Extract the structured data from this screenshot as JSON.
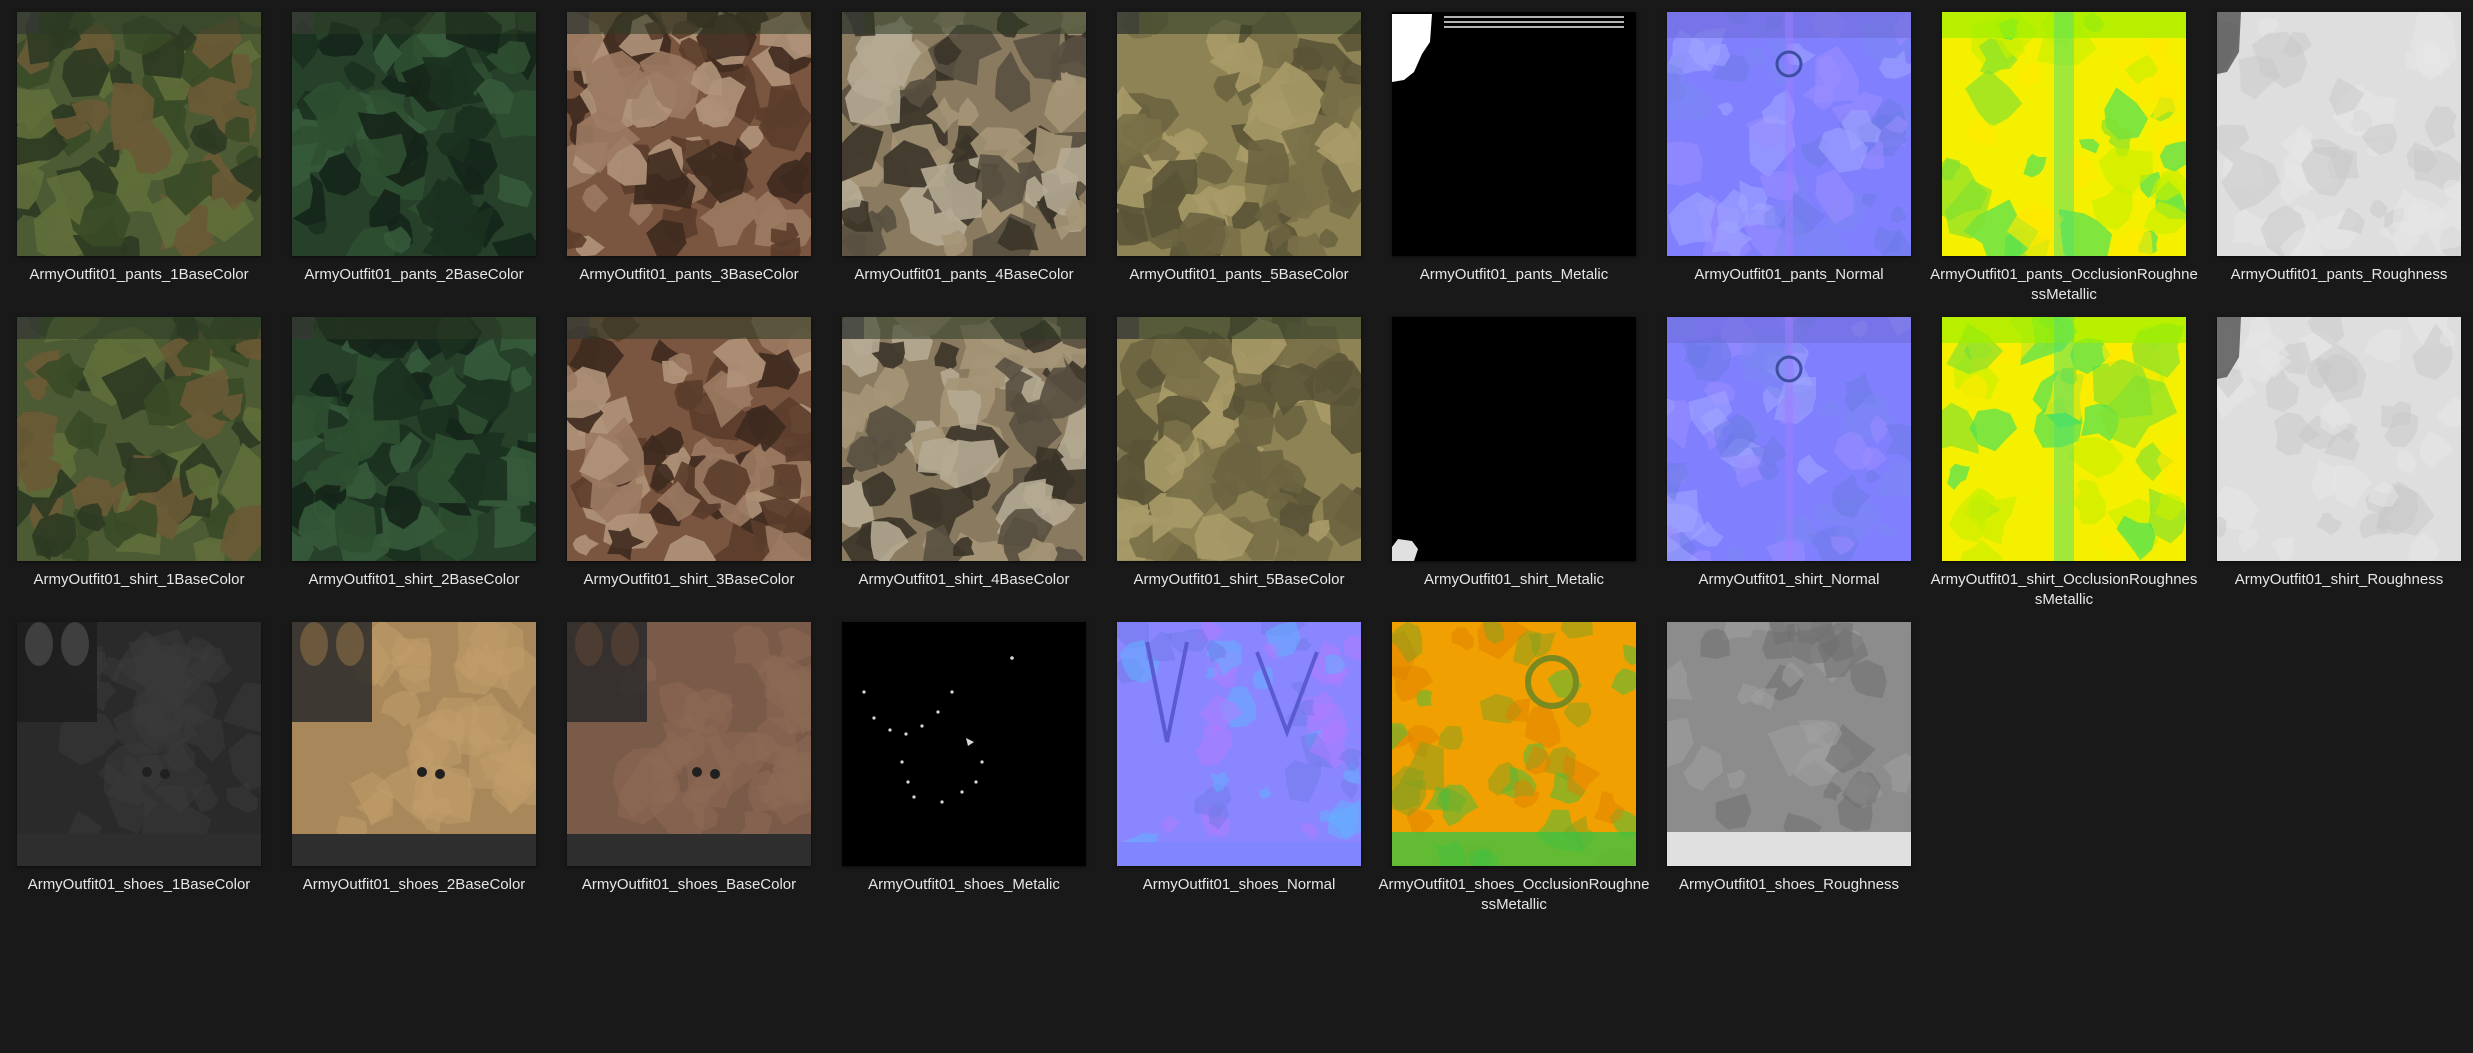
{
  "window": {
    "background": "#191919"
  },
  "files": [
    {
      "name": "ArmyOutfit01_pants_1BaseColor",
      "kind": "camo",
      "colors": [
        "#4c5b33",
        "#3a4a27",
        "#6a5a35",
        "#2e3a22",
        "#5f6e3a"
      ]
    },
    {
      "name": "ArmyOutfit01_pants_2BaseColor",
      "kind": "camo",
      "colors": [
        "#26402a",
        "#1c3120",
        "#355a3a",
        "#15251a",
        "#2f4f31"
      ]
    },
    {
      "name": "ArmyOutfit01_pants_3BaseColor",
      "kind": "camo",
      "colors": [
        "#7a5640",
        "#5b3d2b",
        "#9b7a62",
        "#3e2a1f",
        "#b0937a"
      ]
    },
    {
      "name": "ArmyOutfit01_pants_4BaseColor",
      "kind": "camo",
      "colors": [
        "#8a7b60",
        "#b5aa92",
        "#3b3428",
        "#a59677",
        "#595041"
      ]
    },
    {
      "name": "ArmyOutfit01_pants_5BaseColor",
      "kind": "camo",
      "colors": [
        "#8d8354",
        "#6b6340",
        "#a89b68",
        "#5a5336",
        "#7a7048"
      ]
    },
    {
      "name": "ArmyOutfit01_pants_Metalic",
      "kind": "metalic_pants",
      "colors": [
        "#000000",
        "#ffffff"
      ]
    },
    {
      "name": "ArmyOutfit01_pants_Normal",
      "kind": "normal",
      "colors": [
        "#8080ff",
        "#7a86f0",
        "#9a8cff",
        "#6c7ae6",
        "#a0a6ff"
      ]
    },
    {
      "name": "ArmyOutfit01_pants_OcclusionRoughnessMetallic",
      "kind": "orm",
      "colors": [
        "#f5f000",
        "#c8f000",
        "#40e060",
        "#ffea00",
        "#7fe030"
      ]
    },
    {
      "name": "ArmyOutfit01_pants_Roughness",
      "kind": "rough",
      "colors": [
        "#dedede",
        "#e8e8e8",
        "#c8c8c8",
        "#505050"
      ]
    },
    {
      "name": "ArmyOutfit01_shirt_1BaseColor",
      "kind": "camo",
      "colors": [
        "#4c5b33",
        "#3a4a27",
        "#6a5a35",
        "#2e3a22",
        "#5f6e3a"
      ]
    },
    {
      "name": "ArmyOutfit01_shirt_2BaseColor",
      "kind": "camo",
      "colors": [
        "#26402a",
        "#1c3120",
        "#355a3a",
        "#15251a",
        "#2f4f31"
      ]
    },
    {
      "name": "ArmyOutfit01_shirt_3BaseColor",
      "kind": "camo",
      "colors": [
        "#7a5640",
        "#5b3d2b",
        "#9b7a62",
        "#3e2a1f",
        "#b0937a"
      ]
    },
    {
      "name": "ArmyOutfit01_shirt_4BaseColor",
      "kind": "camo",
      "colors": [
        "#8a7b60",
        "#b5aa92",
        "#3b3428",
        "#a59677",
        "#595041"
      ]
    },
    {
      "name": "ArmyOutfit01_shirt_5BaseColor",
      "kind": "camo",
      "colors": [
        "#8d8354",
        "#6b6340",
        "#a89b68",
        "#5a5336",
        "#7a7048"
      ]
    },
    {
      "name": "ArmyOutfit01_shirt_Metalic",
      "kind": "metalic_shirt",
      "colors": [
        "#000000",
        "#e0e0e0"
      ]
    },
    {
      "name": "ArmyOutfit01_shirt_Normal",
      "kind": "normal",
      "colors": [
        "#8080ff",
        "#7a86f0",
        "#9a8cff",
        "#6c7ae6",
        "#a0a6ff"
      ]
    },
    {
      "name": "ArmyOutfit01_shirt_OcclusionRoughnessMetallic",
      "kind": "orm",
      "colors": [
        "#f5f000",
        "#c8f000",
        "#40e060",
        "#ffea00",
        "#7fe030"
      ]
    },
    {
      "name": "ArmyOutfit01_shirt_Roughness",
      "kind": "rough",
      "colors": [
        "#dedede",
        "#e8e8e8",
        "#c8c8c8",
        "#505050"
      ]
    },
    {
      "name": "ArmyOutfit01_shoes_1BaseColor",
      "kind": "shoes",
      "colors": [
        "#2a2a2a",
        "#3a3a3a",
        "#1c1c1c",
        "#555555"
      ]
    },
    {
      "name": "ArmyOutfit01_shoes_2BaseColor",
      "kind": "shoes",
      "colors": [
        "#a8885a",
        "#c29e6a",
        "#2a2a2a",
        "#8a6e46"
      ]
    },
    {
      "name": "ArmyOutfit01_shoes_BaseColor",
      "kind": "shoes",
      "colors": [
        "#7a5a48",
        "#8e6a55",
        "#2a2a2a",
        "#5e4436"
      ]
    },
    {
      "name": "ArmyOutfit01_shoes_Metalic",
      "kind": "metalic_shoes",
      "colors": [
        "#000000",
        "#d8d8d8"
      ]
    },
    {
      "name": "ArmyOutfit01_shoes_Normal",
      "kind": "shoes_normal",
      "colors": [
        "#8a86ff",
        "#6f7ae8",
        "#b47aff",
        "#5fb4ff"
      ]
    },
    {
      "name": "ArmyOutfit01_shoes_OcclusionRoughnessMetallic",
      "kind": "shoes_orm",
      "colors": [
        "#f0a000",
        "#e08000",
        "#80a020",
        "#40c040"
      ]
    },
    {
      "name": "ArmyOutfit01_shoes_Roughness",
      "kind": "shoes_rough",
      "colors": [
        "#8c8c8c",
        "#a0a0a0",
        "#707070",
        "#e0e0e0"
      ]
    }
  ]
}
